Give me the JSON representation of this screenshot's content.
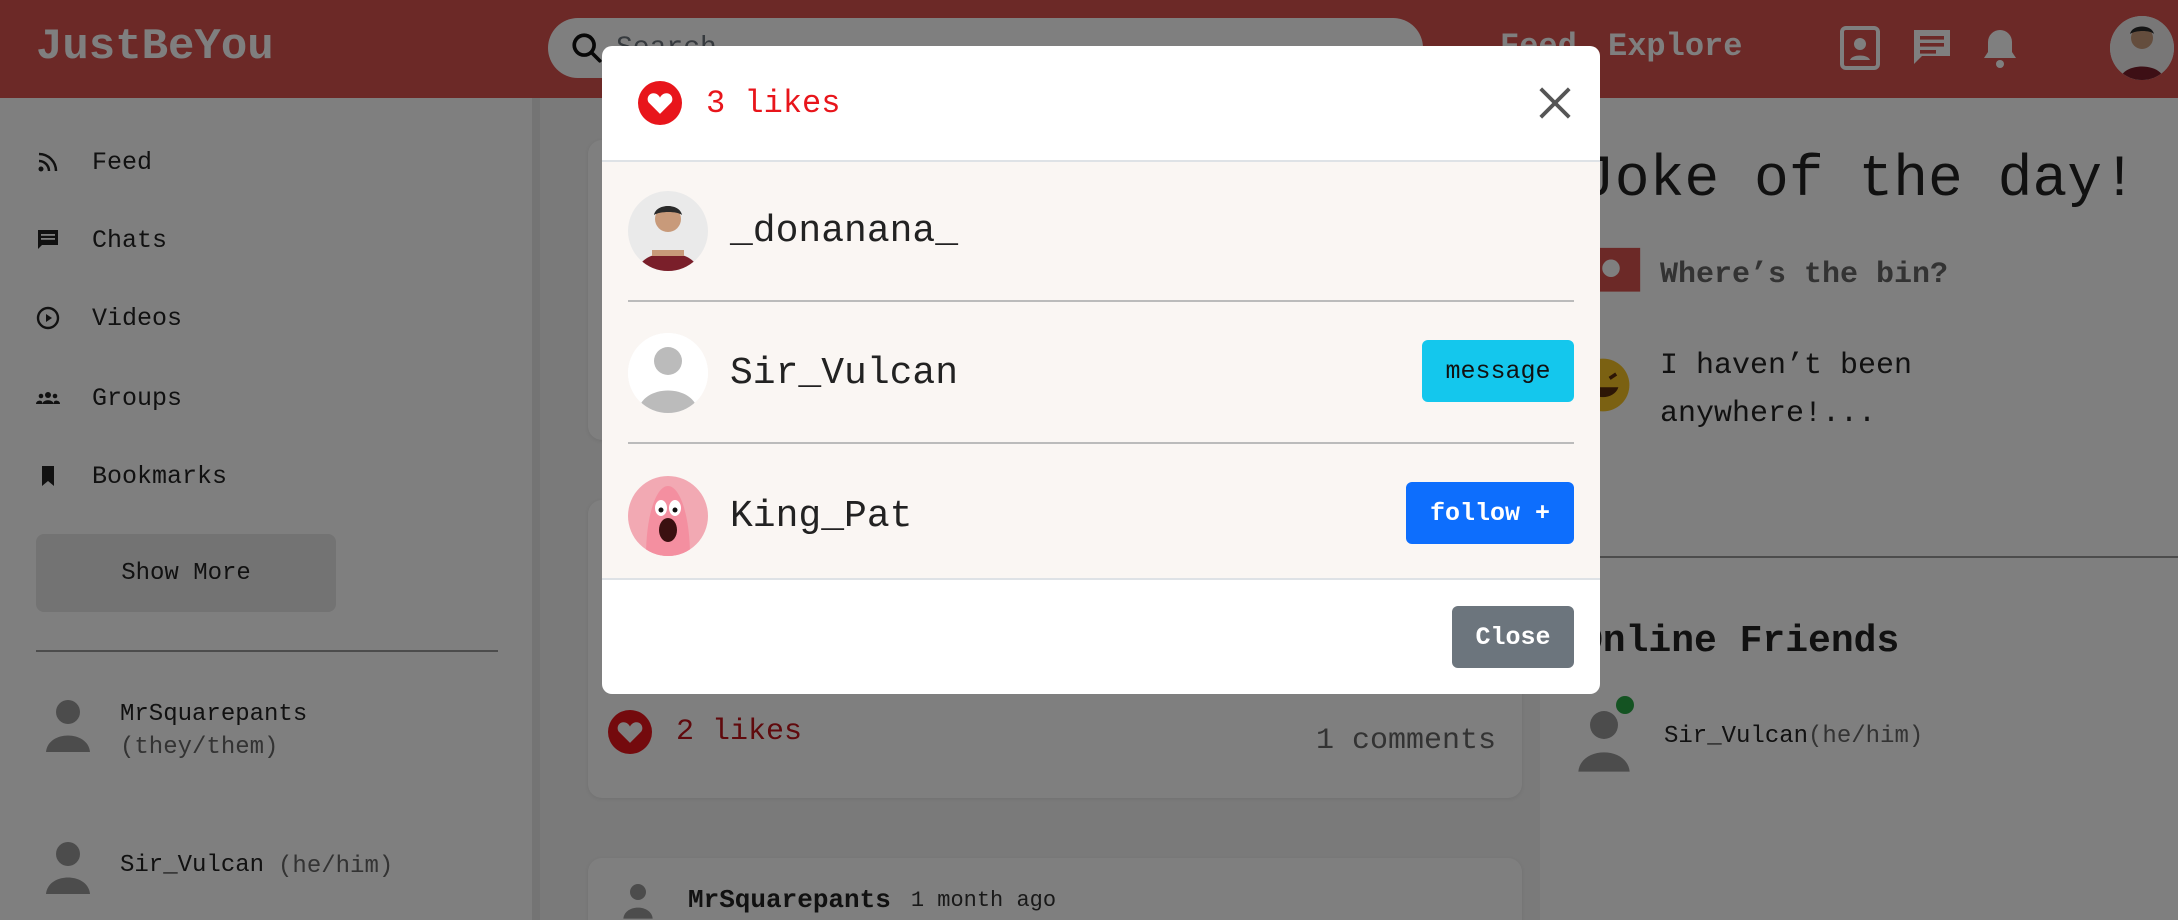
{
  "app": {
    "brand": "JustBeYou"
  },
  "search": {
    "placeholder": "Search"
  },
  "nav": {
    "feed": "Feed",
    "explore": "Explore"
  },
  "sidebar": {
    "items": [
      {
        "label": "Feed",
        "icon": "rss-icon"
      },
      {
        "label": "Chats",
        "icon": "chat-icon"
      },
      {
        "label": "Videos",
        "icon": "play-icon"
      },
      {
        "label": "Groups",
        "icon": "groups-icon"
      },
      {
        "label": "Bookmarks",
        "icon": "bookmark-icon"
      }
    ],
    "show_more": "Show More",
    "friends": [
      {
        "name": "MrSquarepants",
        "pronouns": "(they/them)"
      },
      {
        "name": "Sir_Vulcan",
        "pronouns": "(he/him)"
      }
    ]
  },
  "feed": {
    "post_likes": "2 likes",
    "post_comments": "1 comments",
    "next_post_author": "MrSquarepants",
    "next_post_time": "1 month ago"
  },
  "right": {
    "joke_title": "Joke of the day!",
    "joke_question": "Where’s the bin?",
    "joke_answer": "I haven’t been anywhere!...",
    "online_title": "Online Friends",
    "online_friend": {
      "name": "Sir_Vulcan",
      "pronouns": "(he/him)"
    }
  },
  "modal": {
    "likes_label": "3 likes",
    "likers": [
      {
        "username": "_donanana_",
        "action": ""
      },
      {
        "username": "Sir_Vulcan",
        "action": "message"
      },
      {
        "username": "King_Pat",
        "action": "follow +"
      }
    ],
    "close_label": "Close"
  },
  "colors": {
    "brand": "#d9534f",
    "like_red": "#e8151b",
    "message_btn": "#14c7ed",
    "follow_btn": "#0d6efd",
    "close_btn": "#6c757d",
    "online_dot": "#28a745"
  }
}
